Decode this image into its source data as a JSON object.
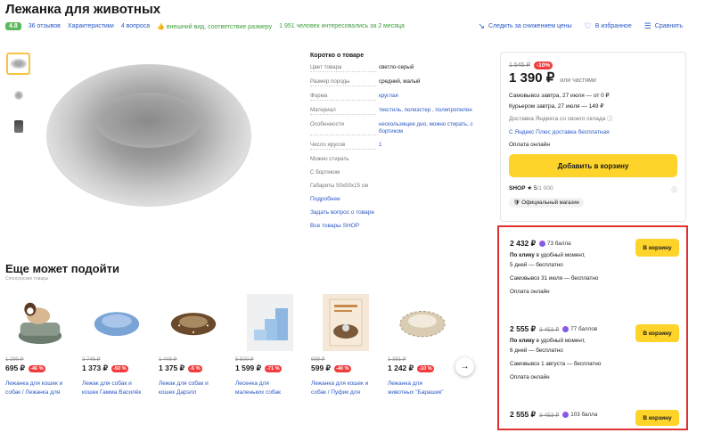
{
  "title": "Лежанка для животных",
  "meta": {
    "rating": "4.8",
    "reviews": "36 отзывов",
    "characteristics": "Характеристики",
    "questions": "4 вопроса",
    "praise": "внешний вид, соответствие размеру",
    "interest": "1 951 человек интересовались за 2 месяца"
  },
  "actions": {
    "track_price": "Следить за снижением цены",
    "favorites": "В избранное",
    "compare": "Сравнить"
  },
  "short": {
    "heading": "Коротко о товаре",
    "specs": [
      {
        "k": "Цвет товара",
        "v": "светло-серый",
        "link": false
      },
      {
        "k": "Размер породы",
        "v": "средний, малый",
        "link": false
      },
      {
        "k": "Форма",
        "v": "круглая",
        "link": true
      },
      {
        "k": "Материал",
        "v": "текстиль, полиэстер , полипропилен",
        "link": true
      },
      {
        "k": "Особенности",
        "v": "нескользящее дно, можно стирать, с бортиком",
        "link": true
      },
      {
        "k": "Число ярусов",
        "v": "1",
        "link": true
      }
    ],
    "single": [
      "Можно стирать",
      "С бортиком",
      "Габариты 50x50x15 см"
    ],
    "links": [
      "Подробнее",
      "Задать вопрос о товаре",
      "Все товары SHOP"
    ]
  },
  "price_card": {
    "old_price": "1 545 ₽",
    "discount": "-10%",
    "price": "1 390 ₽",
    "installments": "или частями",
    "pickup": "Самовывоз завтра, 27 июля — от 0 ₽",
    "courier": "Курьером завтра, 27 июля — 149 ₽",
    "warehouse": "Доставка Яндекса со своего склада",
    "plus": "С Яндекс Плюс доставка бесплатная",
    "payment": "Оплата онлайн",
    "add_button": "Добавить в корзину",
    "shop_name": "SHOP",
    "shop_rating": "★ 5",
    "shop_reviews": "/1 000",
    "official": "Официальный магазин"
  },
  "offers": [
    {
      "price": "2 432 ₽",
      "old": "",
      "bonus": "73 балла",
      "lines": [
        "По клику в удобный момент,",
        "5 дней — бесплатно",
        "Самовывоз 31 июля — бесплатно",
        "Оплата онлайн"
      ],
      "button": "В корзину"
    },
    {
      "price": "2 555 ₽",
      "old": "3 453 ₽",
      "bonus": "77 баллов",
      "lines": [
        "По клику в удобный момент,",
        "6 дней — бесплатно",
        "Самовывоз 1 августа — бесплатно",
        "Оплата онлайн"
      ],
      "button": "В корзину"
    },
    {
      "price": "2 555 ₽",
      "old": "3 453 ₽",
      "bonus": "103 балла",
      "lines": [],
      "button": "В корзину"
    }
  ],
  "more": {
    "title": "Еще может подойти",
    "sponsored": "Спонсорские товары",
    "items": [
      {
        "old": "1 290 ₽",
        "price": "695 ₽",
        "disc": "-46 %",
        "name1": "Лежанка для кошек и",
        "name2": "собак / Лежанка для"
      },
      {
        "old": "2 746 ₽",
        "price": "1 373 ₽",
        "disc": "-50 %",
        "name1": "Лежак для собак и",
        "name2": "кошек Гамма Василёк"
      },
      {
        "old": "1 448 ₽",
        "price": "1 375 ₽",
        "disc": "-5 %",
        "name1": "Лежак для собак и",
        "name2": "кошек Дарэлл"
      },
      {
        "old": "5 500 ₽",
        "price": "1 599 ₽",
        "disc": "-71 %",
        "name1": "Лесенка для",
        "name2": "маленьких собак"
      },
      {
        "old": "999 ₽",
        "price": "599 ₽",
        "disc": "-40 %",
        "name1": "Лежанка для кошек и",
        "name2": "собак / Пуфик для"
      },
      {
        "old": "1 381 ₽",
        "price": "1 242 ₽",
        "disc": "-10 %",
        "name1": "Лежанка для",
        "name2": "животных \"Барашик\""
      }
    ]
  }
}
